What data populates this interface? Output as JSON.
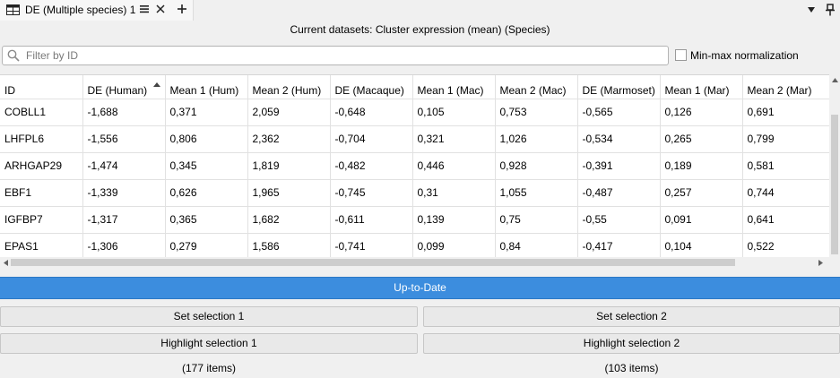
{
  "tab": {
    "title": "DE (Multiple species) 1"
  },
  "current_datasets": "Current datasets: Cluster expression (mean) (Species)",
  "filter": {
    "placeholder": "Filter by ID",
    "value": ""
  },
  "minmax": {
    "label": "Min-max normalization",
    "checked": false
  },
  "table": {
    "columns": [
      "ID",
      "DE (Human)",
      "Mean 1 (Hum)",
      "Mean 2 (Hum)",
      "DE (Macaque)",
      "Mean 1 (Mac)",
      "Mean 2 (Mac)",
      "DE (Marmoset)",
      "Mean 1 (Mar)",
      "Mean 2 (Mar)"
    ],
    "sort_column": "DE (Human)",
    "sort_direction": "ascending",
    "rows": [
      [
        "COBLL1",
        "-1,688",
        "0,371",
        "2,059",
        "-0,648",
        "0,105",
        "0,753",
        "-0,565",
        "0,126",
        "0,691"
      ],
      [
        "LHFPL6",
        "-1,556",
        "0,806",
        "2,362",
        "-0,704",
        "0,321",
        "1,026",
        "-0,534",
        "0,265",
        "0,799"
      ],
      [
        "ARHGAP29",
        "-1,474",
        "0,345",
        "1,819",
        "-0,482",
        "0,446",
        "0,928",
        "-0,391",
        "0,189",
        "0,581"
      ],
      [
        "EBF1",
        "-1,339",
        "0,626",
        "1,965",
        "-0,745",
        "0,31",
        "1,055",
        "-0,487",
        "0,257",
        "0,744"
      ],
      [
        "IGFBP7",
        "-1,317",
        "0,365",
        "1,682",
        "-0,611",
        "0,139",
        "0,75",
        "-0,55",
        "0,091",
        "0,641"
      ],
      [
        "EPAS1",
        "-1,306",
        "0,279",
        "1,586",
        "-0,741",
        "0,099",
        "0,84",
        "-0,417",
        "0,104",
        "0,522"
      ]
    ]
  },
  "status": "Up-to-Date",
  "selection1": {
    "set_label": "Set selection 1",
    "highlight_label": "Highlight selection 1",
    "count": "(177 items)"
  },
  "selection2": {
    "set_label": "Set selection 2",
    "highlight_label": "Highlight selection 2",
    "count": "(103 items)"
  },
  "colors": {
    "status_bar": "#3c8dde",
    "background": "#f0f0f0"
  }
}
